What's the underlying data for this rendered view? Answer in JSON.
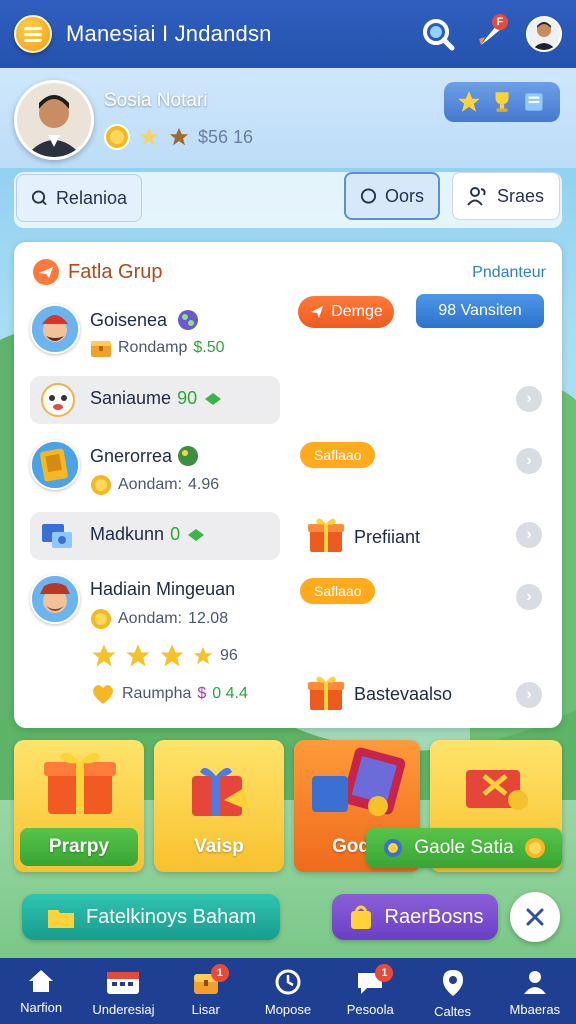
{
  "app": {
    "title": "Manesiai I Jndandsn"
  },
  "header": {
    "notification_badge": "F"
  },
  "profile": {
    "name": "Sosia Notari",
    "score": "$56 16"
  },
  "tabs": {
    "left_label": "Relanioa",
    "mid_label": "Oors",
    "right_label": "Sraes"
  },
  "card": {
    "title": "Fatla Grup",
    "link": "Pndanteur",
    "rows": [
      {
        "name": "Goisenea",
        "sub_label": "Rondamp",
        "sub_value": "$.50",
        "action_orange": "Demge",
        "action_blue": "98 Vansiten"
      },
      {
        "name": "Saniaume",
        "value": "90"
      },
      {
        "name": "Gnerorrea",
        "sub_label": "Aondam:",
        "sub_value": "4.96",
        "tag": "Saflaao"
      },
      {
        "name": "Madkunn",
        "value": "0",
        "gift_label": "Prefiiant"
      },
      {
        "name": "Hadiain Mingeuan",
        "sub_label": "Aondam:",
        "sub_value": "12.08",
        "tag": "Saflaao",
        "stars_value": "96"
      },
      {
        "name": "Raumpha",
        "value": "0 4.4",
        "gift_label": "Bastevaalso"
      }
    ]
  },
  "tiles": [
    {
      "label": "Prarpy"
    },
    {
      "label": "Vaisp"
    },
    {
      "label": "God"
    },
    {
      "label": "Gaole Satia"
    }
  ],
  "buttons": {
    "teal_label": "Fatelkinoys Baham",
    "purple_label": "RaerBosns"
  },
  "nav": [
    {
      "label": "Narfion",
      "icon": "home-icon"
    },
    {
      "label": "Underesiaj",
      "icon": "calendar-icon"
    },
    {
      "label": "Lisar",
      "icon": "chest-icon",
      "badge": "1"
    },
    {
      "label": "Mopose",
      "icon": "clock-icon"
    },
    {
      "label": "Pesoola",
      "icon": "chat-icon",
      "badge": "1"
    },
    {
      "label": "Caltes",
      "icon": "location-icon"
    },
    {
      "label": "Mbaeras",
      "icon": "profile-icon"
    }
  ],
  "colors": {
    "header": "#2452ad",
    "nav": "#1f3f93",
    "accent_orange": "#ee5b1f",
    "accent_blue": "#2d72cc",
    "tag": "#ffab1c"
  }
}
